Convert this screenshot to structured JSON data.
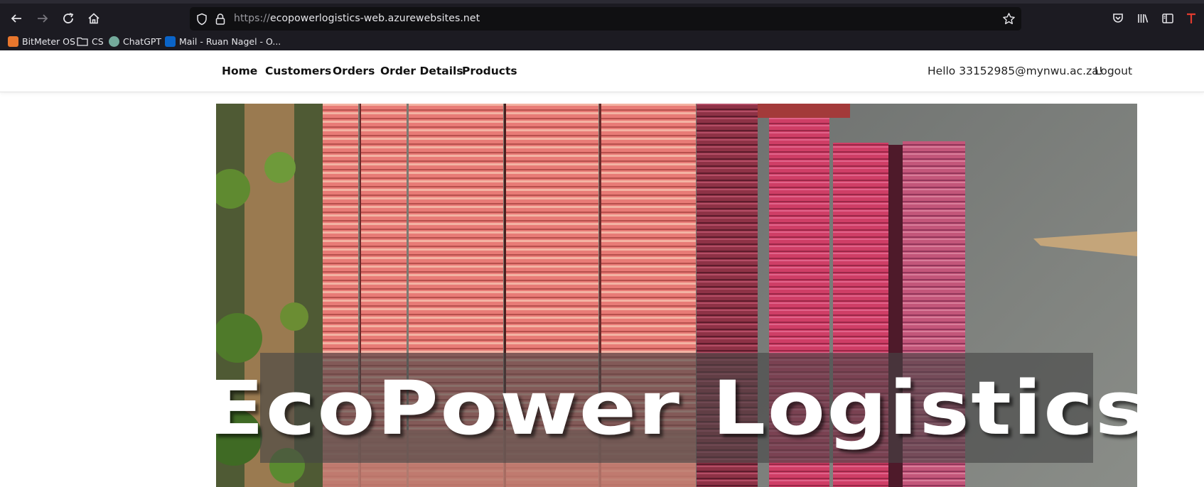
{
  "browser": {
    "url_protocol": "https://",
    "url_host": "ecopowerlogistics-web.azurewebsites.net",
    "bookmarks": [
      {
        "label": "BitMeter OS",
        "icon": "bitmeter-icon",
        "color": "#e8762d"
      },
      {
        "label": "CS",
        "icon": "folder-icon",
        "color": "#e6e6ea"
      },
      {
        "label": "ChatGPT",
        "icon": "chatgpt-icon",
        "color": "#74aa9c"
      },
      {
        "label": "Mail - Ruan Nagel - O...",
        "icon": "outlook-icon",
        "color": "#0a64c8"
      }
    ]
  },
  "nav": {
    "links": [
      "Home",
      "Customers",
      "Orders",
      "Order Details",
      "Products"
    ],
    "greeting": "Hello 33152985@mynwu.ac.za!",
    "logout": "Logout"
  },
  "hero": {
    "title": "EcoPower Logistics"
  },
  "colors": {
    "chrome_bg": "#1c1b22",
    "urlbar_bg": "#101012",
    "container_red": "#e0706d",
    "container_pink": "#c83a62"
  }
}
